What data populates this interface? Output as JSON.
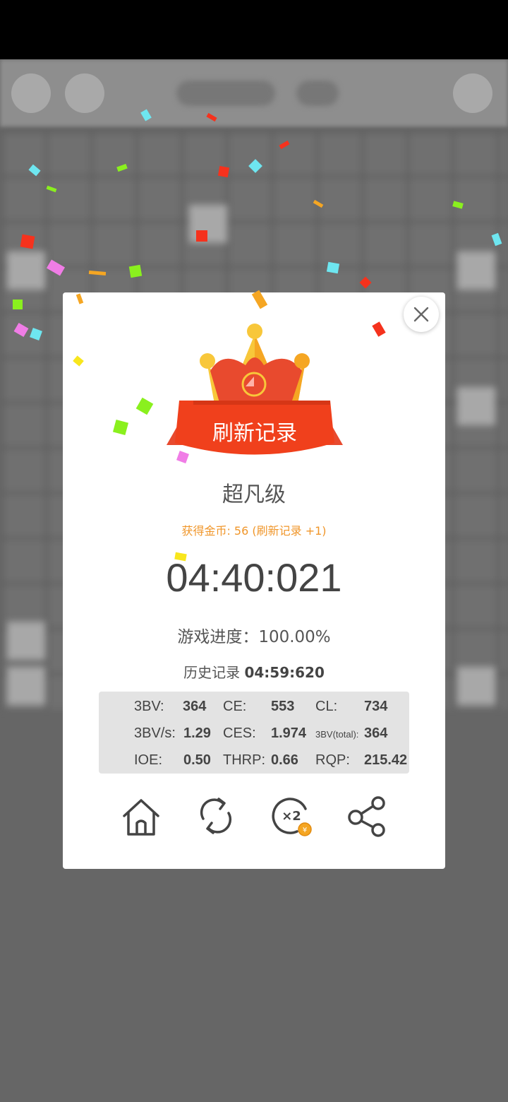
{
  "dialog": {
    "banner": "刷新记录",
    "level": "超凡级",
    "coins": "获得金币: 56 (刷新记录 +1)",
    "time": "04:40:021",
    "progress": "游戏进度：100.00%",
    "history_label": "历史记录",
    "history_value": "04:59:620"
  },
  "stats": {
    "row1": [
      {
        "label": "3BV:",
        "value": "364"
      },
      {
        "label": "CE:",
        "value": "553"
      },
      {
        "label": "CL:",
        "value": "734"
      }
    ],
    "row2": [
      {
        "label": "3BV/s:",
        "value": "1.29"
      },
      {
        "label": "CES:",
        "value": "1.974"
      },
      {
        "label": "3BV(total):",
        "value": "364"
      }
    ],
    "row3": [
      {
        "label": "IOE:",
        "value": "0.50"
      },
      {
        "label": "THRP:",
        "value": "0.66"
      },
      {
        "label": "RQP:",
        "value": "215.42"
      }
    ]
  },
  "actions": {
    "home_icon": "home-icon",
    "restart_icon": "restart-icon",
    "double_icon": "double-coins-icon",
    "double_label": "×2",
    "coin_label": "¥",
    "share_icon": "share-icon"
  },
  "colors": {
    "crown_red": "#e84a2e",
    "crown_yellow": "#f8c73a",
    "crown_orange": "#f5a623",
    "coins_text": "#f0962a"
  }
}
